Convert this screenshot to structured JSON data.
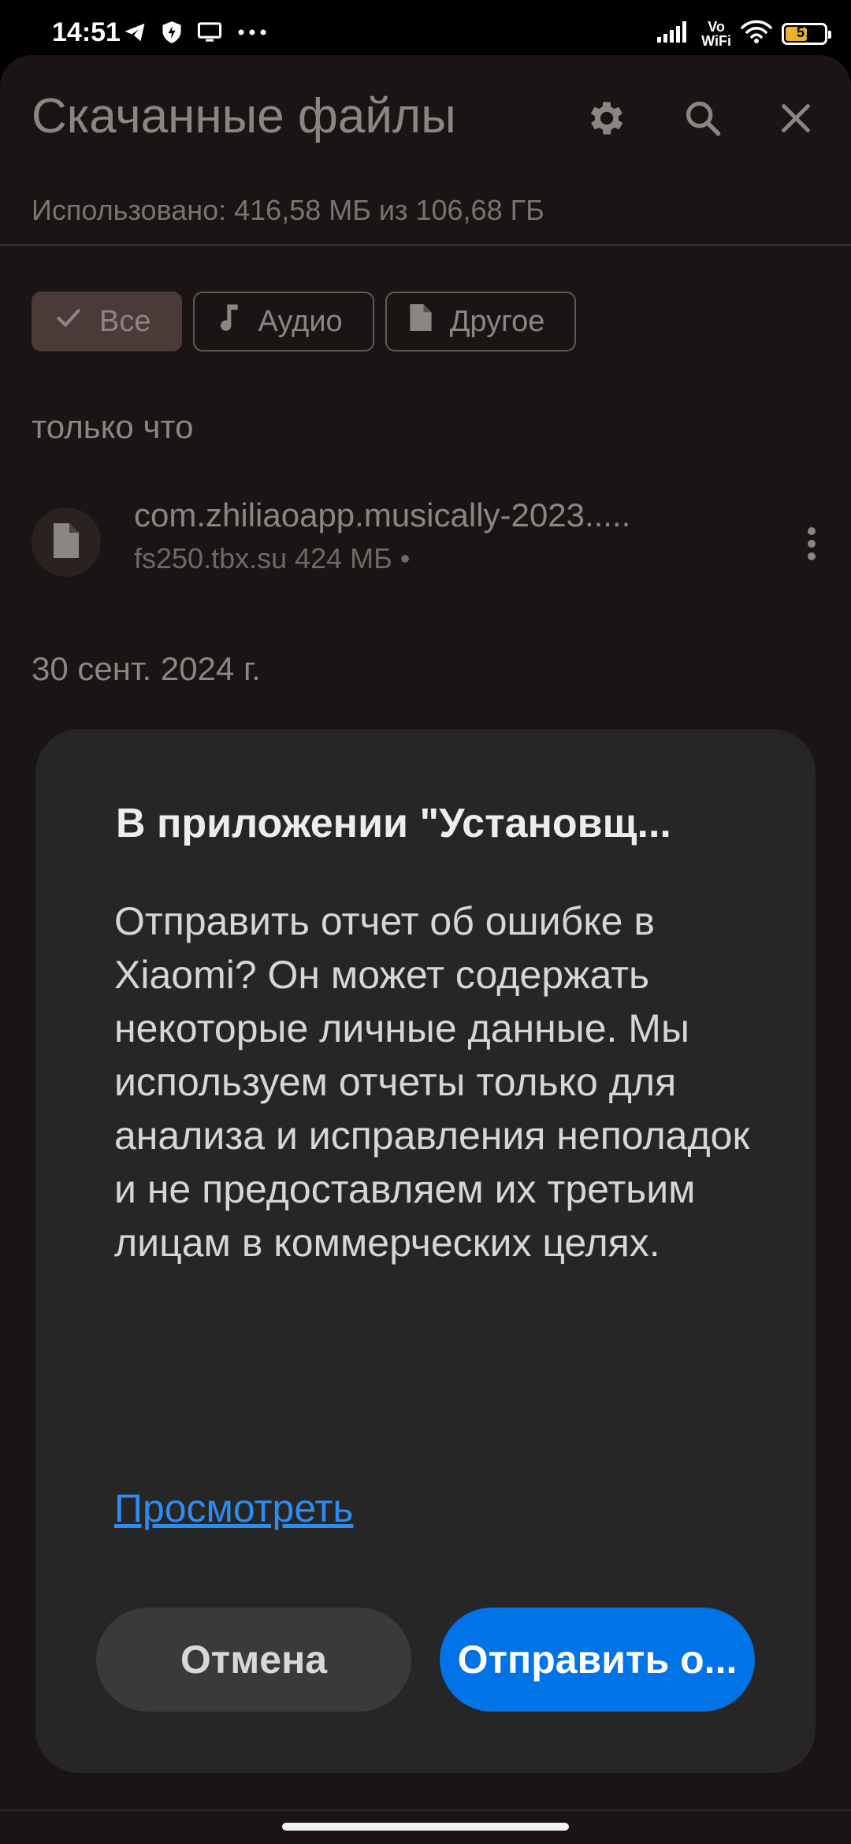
{
  "status_bar": {
    "time": "14:51",
    "network_label_top": "Vo",
    "network_label_bottom": "WiFi",
    "battery": "57",
    "battery_fraction": 0.57
  },
  "app": {
    "title": "Скачанные файлы",
    "usage": "Использовано: 416,58 МБ из 106,68 ГБ",
    "toolbar_icons": [
      "gear-icon",
      "search-icon",
      "close-icon"
    ],
    "chips": [
      {
        "label": "Все",
        "icon": "check-icon",
        "selected": true
      },
      {
        "label": "Аудио",
        "icon": "music-note-icon",
        "selected": false
      },
      {
        "label": "Другое",
        "icon": "file-icon",
        "selected": false
      }
    ],
    "sections": [
      {
        "label": "только что",
        "files": [
          {
            "name": "com.zhiliaoapp.musically-2023.....",
            "meta": "fs250.tbx.su 424 МБ •"
          }
        ]
      },
      {
        "label": "30 сент. 2024 г.",
        "files": []
      }
    ]
  },
  "dialog": {
    "title": "В приложении \"Установщ...",
    "message": "Отправить отчет об ошибке в Xiaomi? Он может содержать некоторые личные данные. Мы используем отчеты только для анализа и исправления неполадок и не предоставляем их третьим лицам в коммерческих целях.",
    "link": "Просмотреть",
    "cancel_label": "Отмена",
    "confirm_label": "Отправить о...",
    "confirm_color": "#0073e6",
    "link_color": "#2d8cf0"
  }
}
